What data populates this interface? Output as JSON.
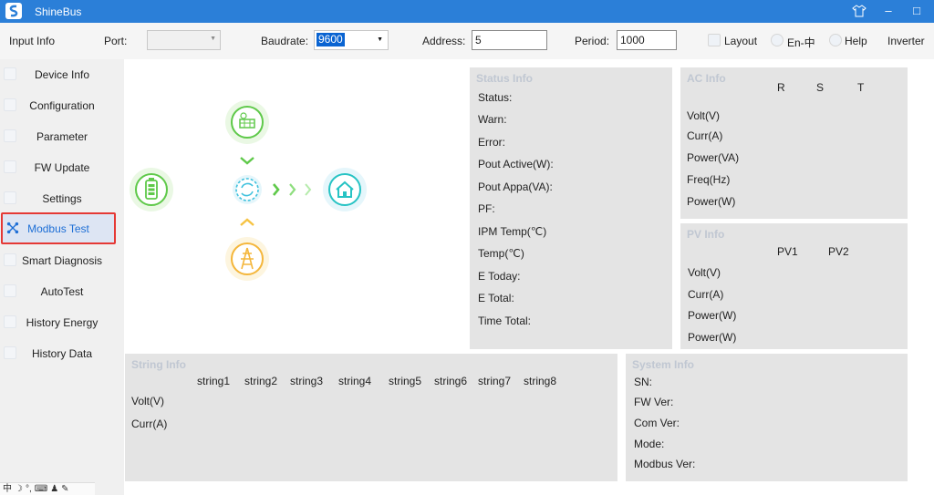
{
  "window": {
    "title": "ShineBus",
    "shirt_icon": "shirt-icon",
    "minimize_glyph": "–",
    "maximize_glyph": "□"
  },
  "toolbar": {
    "input_info": "Input Info",
    "port_label": "Port:",
    "port_value": "",
    "baudrate_label": "Baudrate:",
    "baudrate_value": "9600",
    "address_label": "Address:",
    "address_value": "5",
    "period_label": "Period:",
    "period_value": "1000",
    "layout_label": "Layout",
    "lang_label": "En-中",
    "help_label": "Help",
    "inverter_label": "Inverter"
  },
  "sidebar": {
    "items": [
      {
        "label": "Device Info"
      },
      {
        "label": "Configuration"
      },
      {
        "label": "Parameter"
      },
      {
        "label": "FW Update"
      },
      {
        "label": "Settings"
      },
      {
        "label": "Modbus Test"
      },
      {
        "label": "Smart Diagnosis"
      },
      {
        "label": "AutoTest"
      },
      {
        "label": "History Energy"
      },
      {
        "label": "History Data"
      }
    ],
    "active_index": 5
  },
  "status_info": {
    "title": "Status Info",
    "rows": [
      "Status:",
      "Warn:",
      "Error:",
      "Pout Active(W):",
      "Pout Appa(VA):",
      "PF:",
      "IPM Temp(℃)",
      "Temp(℃)",
      "E Today:",
      "E Total:",
      "Time Total:"
    ]
  },
  "ac_info": {
    "title": "AC Info",
    "columns": [
      "R",
      "S",
      "T"
    ],
    "rows": [
      "Volt(V)",
      "Curr(A)",
      "Power(VA)",
      "Freq(Hz)",
      "Power(W)"
    ]
  },
  "pv_info": {
    "title": "PV Info",
    "columns": [
      "PV1",
      "PV2"
    ],
    "rows": [
      "Volt(V)",
      "Curr(A)",
      "Power(W)",
      "Power(W)"
    ]
  },
  "string_info": {
    "title": "String Info",
    "columns": [
      "string1",
      "string2",
      "string3",
      "string4",
      "string5",
      "string6",
      "string7",
      "string8"
    ],
    "rows": [
      "Volt(V)",
      "Curr(A)"
    ]
  },
  "system_info": {
    "title": "System Info",
    "rows": [
      "SN:",
      "FW Ver:",
      "Com Ver:",
      "Mode:",
      "Modbus Ver:"
    ]
  },
  "status_strip": {
    "glyphs": [
      "中",
      "☽",
      "°,",
      "⌨",
      "♟",
      "✎"
    ]
  },
  "colors": {
    "titlebar": "#2b7fd8",
    "accent": "#1e6fd6",
    "active_border": "#e53935",
    "panel_bg": "#e4e4e4",
    "panel_title": "#c0c7d2"
  }
}
